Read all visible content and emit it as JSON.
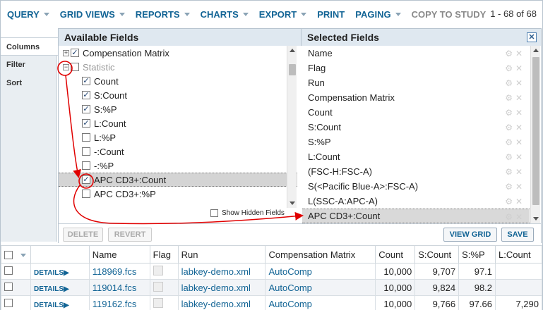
{
  "toolbar": {
    "items": [
      "QUERY",
      "GRID VIEWS",
      "REPORTS",
      "CHARTS",
      "EXPORT",
      "PRINT",
      "PAGING",
      "COPY TO STUDY"
    ],
    "pager": "1 - 68 of 68"
  },
  "sidetabs": [
    "Columns",
    "Filter",
    "Sort"
  ],
  "available": {
    "title": "Available Fields",
    "rows": [
      {
        "label": "Compensation Matrix",
        "checked": true,
        "expander": "+"
      },
      {
        "label": "Statistic",
        "checked": false,
        "expander": "−"
      },
      {
        "label": "Count",
        "checked": true
      },
      {
        "label": "S:Count",
        "checked": true
      },
      {
        "label": "S:%P",
        "checked": true
      },
      {
        "label": "L:Count",
        "checked": true
      },
      {
        "label": "L:%P",
        "checked": false
      },
      {
        "label": "-:Count",
        "checked": false
      },
      {
        "label": "-:%P",
        "checked": false
      },
      {
        "label": "APC CD3+:Count",
        "checked": true
      },
      {
        "label": "APC CD3+:%P",
        "checked": false
      }
    ],
    "show_hidden_label": "Show Hidden Fields"
  },
  "selected": {
    "title": "Selected Fields",
    "close_glyph": "✕",
    "rows": [
      "Name",
      "Flag",
      "Run",
      "Compensation Matrix",
      "Count",
      "S:Count",
      "S:%P",
      "L:Count",
      "(FSC-H:FSC-A)",
      "S(<Pacific Blue-A>:FSC-A)",
      "L(SSC-A:APC-A)",
      "APC CD3+:Count"
    ]
  },
  "buttons": {
    "delete": "DELETE",
    "revert": "REVERT",
    "view_grid": "VIEW GRID",
    "save": "SAVE"
  },
  "grid": {
    "headers": [
      "Name",
      "Flag",
      "Run",
      "Compensation Matrix",
      "Count",
      "S:Count",
      "S:%P",
      "L:Count"
    ],
    "details_label": "DETAILS",
    "rows": [
      {
        "name": "118969.fcs",
        "run": "labkey-demo.xml",
        "comp": "AutoComp",
        "count": "10,000",
        "scount": "9,707",
        "sp": "97.1",
        "lcount": ""
      },
      {
        "name": "119014.fcs",
        "run": "labkey-demo.xml",
        "comp": "AutoComp",
        "count": "10,000",
        "scount": "9,824",
        "sp": "98.2",
        "lcount": ""
      },
      {
        "name": "119162.fcs",
        "run": "labkey-demo.xml",
        "comp": "AutoComp",
        "count": "10,000",
        "scount": "9,766",
        "sp": "97.66",
        "lcount": "7,290"
      }
    ]
  },
  "colors": {
    "accent": "#126495",
    "annotation": "#e00000"
  }
}
